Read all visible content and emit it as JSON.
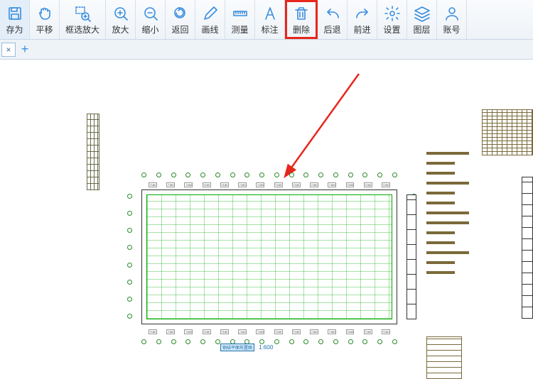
{
  "toolbar": [
    {
      "id": "saveas",
      "label": "存为"
    },
    {
      "id": "pan",
      "label": "平移"
    },
    {
      "id": "zoomwin",
      "label": "框选放大"
    },
    {
      "id": "zoomin",
      "label": "放大"
    },
    {
      "id": "zoomout",
      "label": "缩小"
    },
    {
      "id": "return",
      "label": "返回"
    },
    {
      "id": "drawline",
      "label": "画线"
    },
    {
      "id": "measure",
      "label": "测量"
    },
    {
      "id": "annotate",
      "label": "标注"
    },
    {
      "id": "delete",
      "label": "删除"
    },
    {
      "id": "undo",
      "label": "后退"
    },
    {
      "id": "redo",
      "label": "前进"
    },
    {
      "id": "settings",
      "label": "设置"
    },
    {
      "id": "layers",
      "label": "图层"
    },
    {
      "id": "account",
      "label": "账号"
    }
  ],
  "highlighted_tool": "delete",
  "tabs": {
    "close": "×",
    "add": "+"
  },
  "drawing": {
    "footer_tag": "钢结平面布置图",
    "scale": "1:600",
    "top_labels": [
      "7180",
      "7180",
      "7180",
      "7180",
      "7180",
      "7180",
      "7180",
      "7180",
      "7180",
      "7180",
      "7180",
      "7180",
      "7180",
      "7180"
    ],
    "bot_labels": [
      "7180",
      "7180",
      "7180",
      "7180",
      "7180",
      "7180",
      "7180",
      "7180",
      "7180",
      "7180",
      "7180",
      "7180",
      "7180",
      "7180"
    ],
    "grid_bubbles_h": 18,
    "grid_bubbles_v": 8
  }
}
